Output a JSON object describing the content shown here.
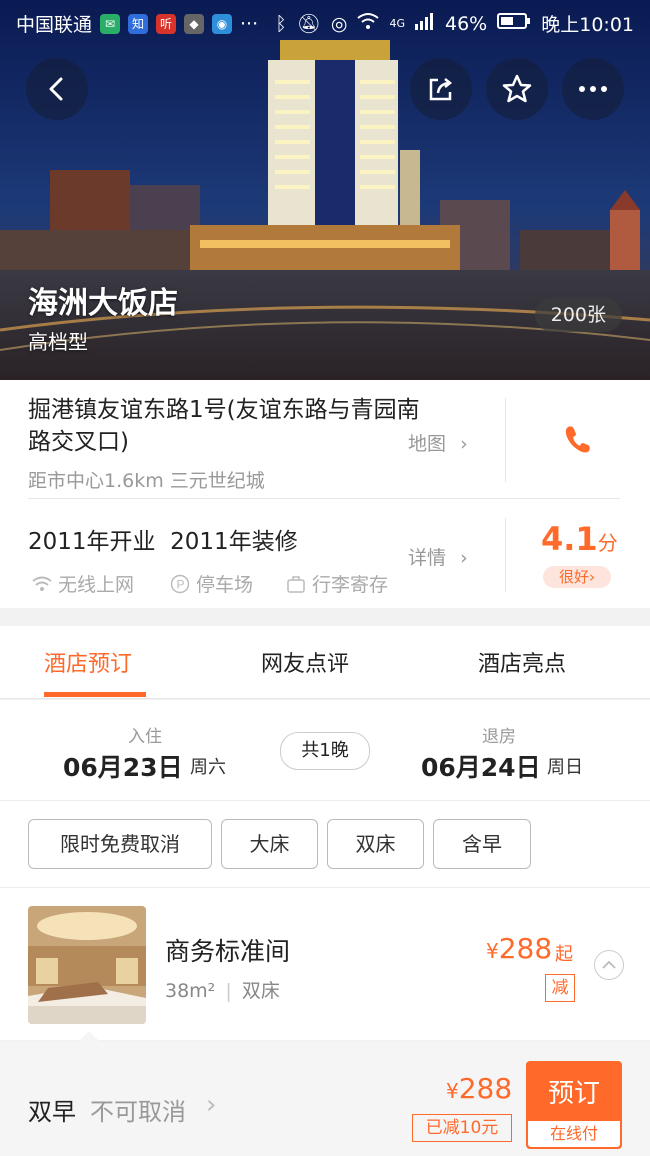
{
  "status_bar": {
    "carrier": "中国联通",
    "app_icons": [
      "wechat-icon",
      "zhihu-icon",
      "ting-icon",
      "box-icon",
      "message-icon"
    ],
    "more": "···",
    "battery": "46%",
    "network": "4G",
    "time": "晚上10:01"
  },
  "hero": {
    "hotel_name": "海洲大饭店",
    "hotel_type": "高档型",
    "photo_count": "200张",
    "buttons": [
      "back-icon",
      "share-icon",
      "star-icon",
      "more-icon"
    ]
  },
  "info": {
    "address": "掘港镇友谊东路1号(友谊东路与青园南路交叉口)",
    "distance": "距市中心1.6km 三元世纪城",
    "map_link": "地图",
    "opened": "2011年开业  2011年装修",
    "facilities": [
      "无线上网",
      "停车场",
      "行李寄存"
    ],
    "detail_link": "详情",
    "score": "4.1",
    "score_unit": "分",
    "rating_text": "很好"
  },
  "tabs": [
    {
      "label": "酒店预订",
      "active": true
    },
    {
      "label": "网友点评",
      "active": false
    },
    {
      "label": "酒店亮点",
      "active": false
    }
  ],
  "dates": {
    "checkin_label": "入住",
    "checkin_date": "06月23日",
    "checkin_week": "周六",
    "nights": "共1晚",
    "checkout_label": "退房",
    "checkout_date": "06月24日",
    "checkout_week": "周日"
  },
  "filters": [
    "限时免费取消",
    "大床",
    "双床",
    "含早"
  ],
  "room": {
    "name": "商务标准间",
    "area": "38m²",
    "bed": "双床",
    "price_symbol": "¥",
    "price": "288",
    "price_suffix": "起",
    "discount_tag": "减"
  },
  "rate_plan": {
    "meal": "双早",
    "policy": "不可取消",
    "price_symbol": "¥",
    "price": "288",
    "discount": "已减10元",
    "book_label": "预订",
    "pay_type": "在线付"
  },
  "colors": {
    "accent": "#ff6a2b",
    "text": "#222222",
    "muted": "#999999"
  }
}
